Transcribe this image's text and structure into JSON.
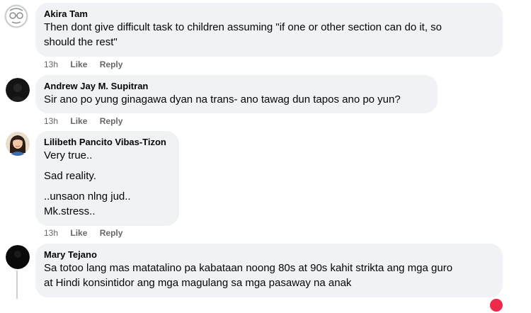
{
  "comments": [
    {
      "author": "Akira Tam",
      "lines": [
        "Then dont give difficult task to children assuming \"if one or other section can do it, so",
        "should the rest\""
      ],
      "time": "13h",
      "like": "Like",
      "reply": "Reply"
    },
    {
      "author": "Andrew Jay M. Supitran",
      "lines": [
        "Sir ano po yung ginagawa dyan na trans- ano tawag dun tapos ano po yun?"
      ],
      "time": "13h",
      "like": "Like",
      "reply": "Reply"
    },
    {
      "author": "Lilibeth Pancito Vibas-Tizon",
      "lines": [
        "Very true..",
        "Sad reality.",
        "..unsaon nlng jud..",
        "Mk.stress.."
      ],
      "time": "13h",
      "like": "Like",
      "reply": "Reply"
    },
    {
      "author": "Mary Tejano",
      "lines": [
        "Sa totoo lang mas matatalino pa kabataan noong 80s at 90s kahit strikta ang mga guro",
        "at Hindi konsintidor ang mga magulang sa mga pasaway na anak"
      ]
    }
  ],
  "colors": {
    "bubble": "#f0f2f5",
    "meta": "#65676b",
    "reaction": "#f02849"
  },
  "icons": [
    "avatar-akira-icon",
    "avatar-andrew-icon",
    "avatar-lilibeth-icon",
    "avatar-mary-icon",
    "reaction-icon"
  ]
}
